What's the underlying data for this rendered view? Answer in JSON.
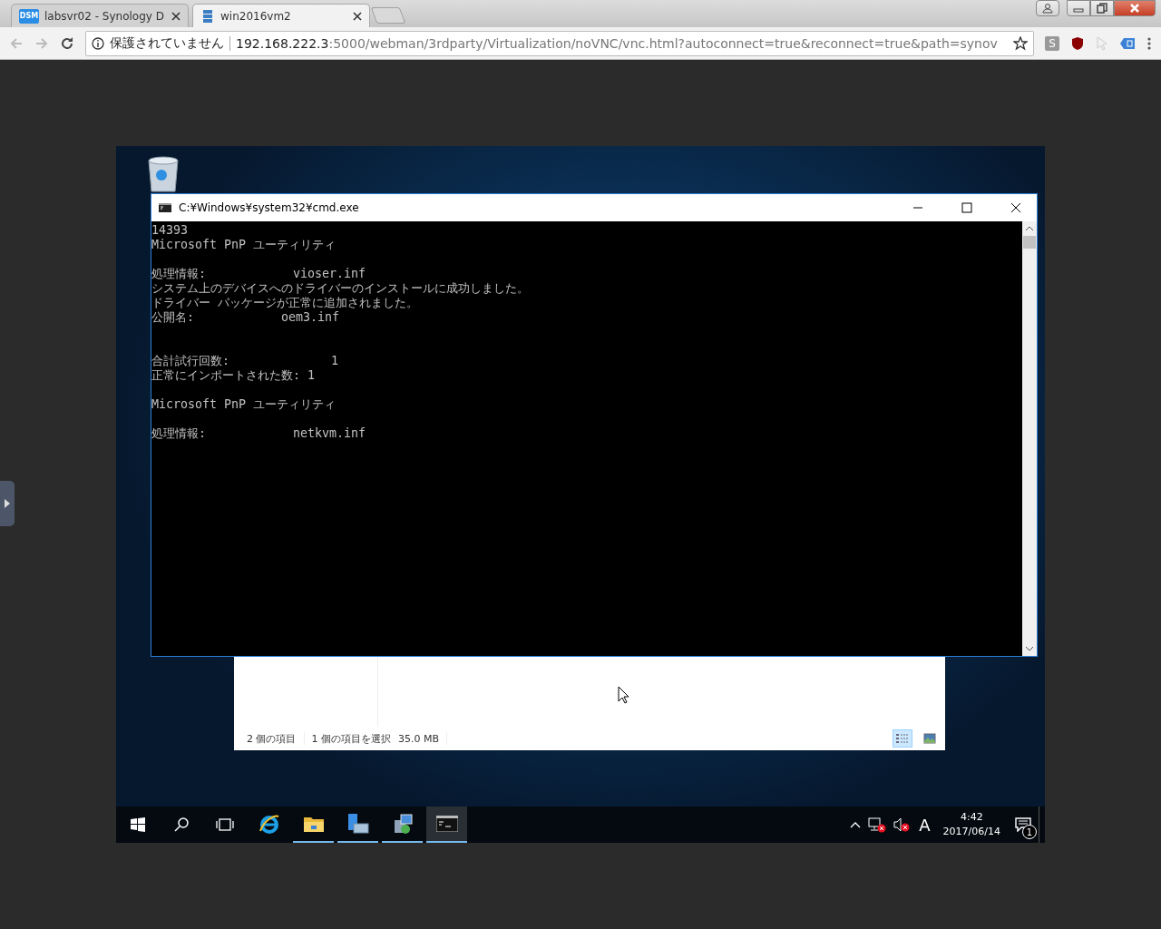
{
  "browser": {
    "tabs": [
      {
        "title": "labsvr02 - Synology D",
        "favicon": "DSM",
        "kind": "dsm",
        "selected": false
      },
      {
        "title": "win2016vm2",
        "kind": "server",
        "selected": true
      }
    ],
    "security_label": "保護されていません",
    "url_host": "192.168.222.3",
    "url_rest": ":5000/webman/3rdparty/Virtualization/noVNC/vnc.html?autoconnect=true&reconnect=true&path=synov",
    "extension_letter": "S"
  },
  "cmd_window": {
    "title": "C:¥Windows¥system32¥cmd.exe",
    "lines": [
      {
        "kind": "text",
        "text": "14393"
      },
      {
        "kind": "text",
        "text": "Microsoft PnP ユーティリティ"
      },
      {
        "kind": "blank"
      },
      {
        "kind": "text",
        "text": "処理情報:            vioser.inf"
      },
      {
        "kind": "text",
        "text": "システム上のデバイスへのドライバーのインストールに成功しました。"
      },
      {
        "kind": "text",
        "text": "ドライバー パッケージが正常に追加されました。"
      },
      {
        "kind": "text",
        "text": "公開名:            oem3.inf"
      },
      {
        "kind": "blank"
      },
      {
        "kind": "blank"
      },
      {
        "kind": "text",
        "text": "合計試行回数:              1"
      },
      {
        "kind": "text",
        "text": "正常にインポートされた数: 1"
      },
      {
        "kind": "blank"
      },
      {
        "kind": "text",
        "text": "Microsoft PnP ユーティリティ"
      },
      {
        "kind": "blank"
      },
      {
        "kind": "text",
        "text": "処理情報:            netkvm.inf"
      }
    ]
  },
  "explorer": {
    "item_count": "2 個の項目",
    "selection": "1 個の項目を選択",
    "size": "35.0 MB",
    "views": [
      {
        "kind": "details",
        "selected": true
      },
      {
        "kind": "large",
        "selected": false
      }
    ]
  },
  "taskbar": {
    "apps": [
      {
        "kind": "ie",
        "running": false,
        "active": false
      },
      {
        "kind": "explorer",
        "running": true,
        "active": false
      },
      {
        "kind": "server",
        "running": true,
        "active": false
      },
      {
        "kind": "installer",
        "running": true,
        "active": false
      },
      {
        "kind": "cmd",
        "running": true,
        "active": true
      }
    ],
    "ime": "A",
    "time": "4:42",
    "date": "2017/06/14",
    "notifications": "1"
  }
}
